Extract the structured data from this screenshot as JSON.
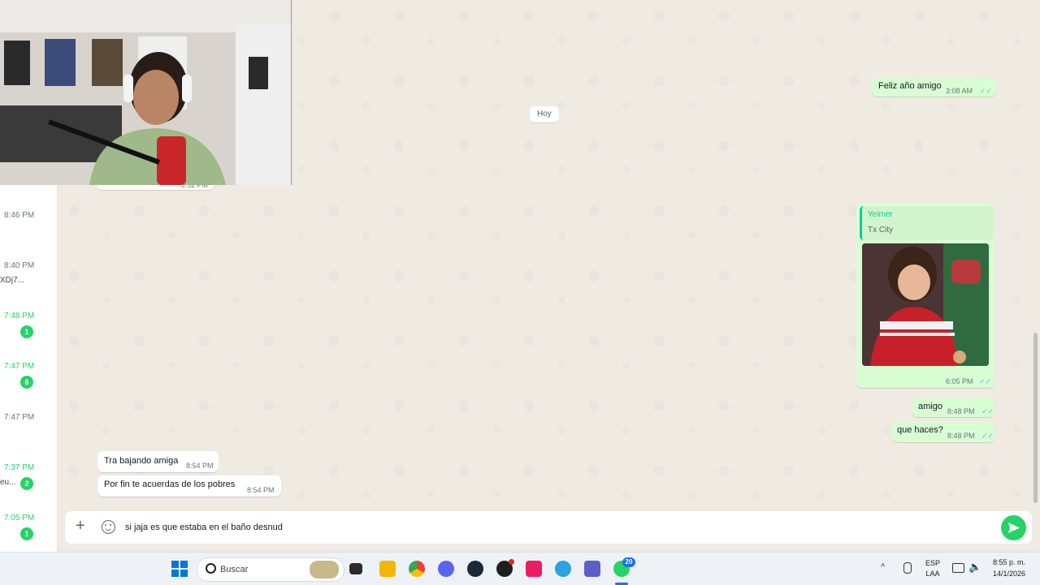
{
  "sidebar": {
    "items": [
      {
        "time": "8:46 PM",
        "unread": false,
        "snippet": "",
        "badge": ""
      },
      {
        "time": "8:40 PM",
        "unread": false,
        "snippet": "XDj7...",
        "badge": ""
      },
      {
        "time": "7:48 PM",
        "unread": true,
        "snippet": "",
        "badge": "1"
      },
      {
        "time": "7:47 PM",
        "unread": true,
        "snippet": "",
        "badge": "6"
      },
      {
        "time": "7:47 PM",
        "unread": false,
        "snippet": "",
        "badge": ""
      },
      {
        "time": "7:37 PM",
        "unread": true,
        "snippet": "eu...",
        "badge": "2"
      },
      {
        "time": "7:05 PM",
        "unread": true,
        "snippet": "",
        "badge": "1"
      }
    ]
  },
  "chat": {
    "partial_time": "5:52 PM",
    "date_chip": "Hoy",
    "messages": [
      {
        "id": "m1",
        "dir": "out",
        "text": "Feliz año amigo",
        "time": "3:08 AM"
      },
      {
        "id": "m2",
        "dir": "out",
        "reply_author": "Yeimer",
        "reply_text": "Tx City",
        "time": "6:05 PM"
      },
      {
        "id": "m3",
        "dir": "out",
        "text": "amigo",
        "time": "8:48 PM"
      },
      {
        "id": "m4",
        "dir": "out",
        "text": "que haces?",
        "time": "8:48 PM"
      },
      {
        "id": "m5",
        "dir": "in",
        "text": "Tra bajando amiga",
        "time": "8:54 PM"
      },
      {
        "id": "m6",
        "dir": "in",
        "text": "Por fin te acuerdas de los pobres",
        "time": "8:54 PM"
      }
    ],
    "ticks": "✓✓"
  },
  "composer": {
    "value": "si jaja es que estaba en el baño desnud"
  },
  "taskbar": {
    "search_label": "Buscar",
    "lang_top": "ESP",
    "lang_bottom": "LAA",
    "clock_time": "8:55 p. m.",
    "clock_date": "14/1/2026",
    "whatsapp_badge": "20"
  },
  "colors": {
    "out_bubble": "#d9fdd3",
    "in_bubble": "#ffffff",
    "unread_green": "#25d366",
    "send_button": "#25d366",
    "read_tick": "#53bdeb"
  }
}
